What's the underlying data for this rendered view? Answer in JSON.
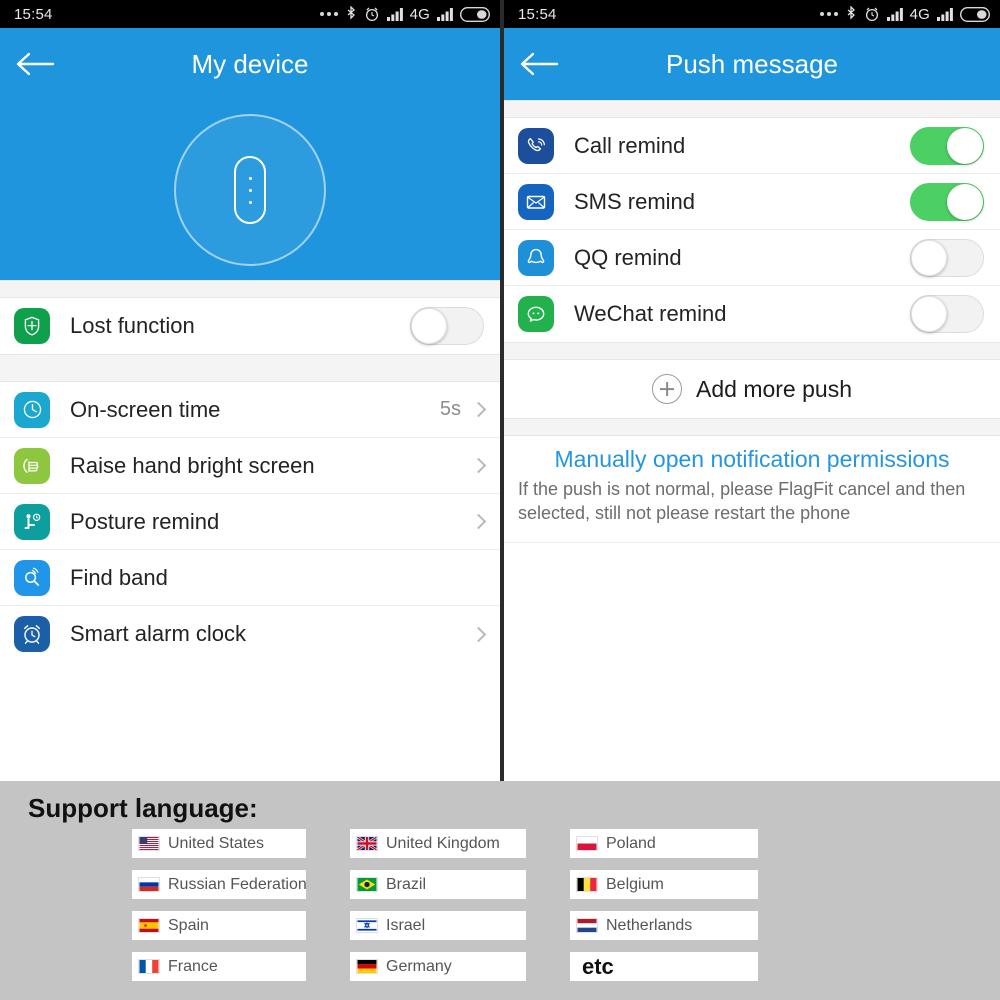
{
  "status_bar": {
    "time": "15:54",
    "icons": [
      "more-dots-icon",
      "bluetooth-icon",
      "alarm-icon",
      "signal-bars-icon",
      "battery-icon"
    ],
    "network": "4G"
  },
  "left_screen": {
    "appbar": {
      "title": "My device",
      "back_icon": "back-arrow-icon"
    },
    "hero": {
      "device_icon": "fitness-band-icon"
    },
    "lost_section": [
      {
        "label": "Lost function",
        "icon": "shield-target-icon",
        "icon_color": "#0ea04a",
        "toggle": "off"
      }
    ],
    "settings_section": [
      {
        "label": "On-screen time",
        "icon": "clock-icon",
        "icon_color": "#1aa8d0",
        "value": "5s",
        "chevron": true
      },
      {
        "label": "Raise hand bright screen",
        "icon": "raise-hand-icon",
        "icon_color": "#8dc63f",
        "value": "",
        "chevron": true
      },
      {
        "label": "Posture remind",
        "icon": "posture-icon",
        "icon_color": "#0d9e9e",
        "value": "",
        "chevron": true
      },
      {
        "label": "Find band",
        "icon": "find-band-icon",
        "icon_color": "#2196e8",
        "value": "",
        "chevron": false
      },
      {
        "label": "Smart alarm clock",
        "icon": "alarm-clock-icon",
        "icon_color": "#1b5fa8",
        "value": "",
        "chevron": true
      }
    ]
  },
  "right_screen": {
    "appbar": {
      "title": "Push message",
      "back_icon": "back-arrow-icon"
    },
    "push_items": [
      {
        "label": "Call remind",
        "icon": "phone-icon",
        "icon_color": "#1c4e9c",
        "toggle": "on"
      },
      {
        "label": "SMS remind",
        "icon": "envelope-icon",
        "icon_color": "#1565c0",
        "toggle": "on"
      },
      {
        "label": "QQ remind",
        "icon": "qq-penguin-icon",
        "icon_color": "#1e90d8",
        "toggle": "off"
      },
      {
        "label": "WeChat remind",
        "icon": "wechat-icon",
        "icon_color": "#22b14c",
        "toggle": "off"
      }
    ],
    "add_more": {
      "label": "Add more push",
      "icon": "plus-circle-icon"
    },
    "permissions": {
      "link": "Manually open notification permissions",
      "note": "If the push is not normal, please FlagFit cancel and then selected, still not please restart the phone"
    }
  },
  "support_language": {
    "title": "Support language:",
    "columns": [
      [
        {
          "name": "United States",
          "flag": "flag-us"
        },
        {
          "name": "Russian Federation",
          "flag": "flag-ru"
        },
        {
          "name": "Spain",
          "flag": "flag-es"
        },
        {
          "name": "France",
          "flag": "flag-fr"
        }
      ],
      [
        {
          "name": "United Kingdom",
          "flag": "flag-gb"
        },
        {
          "name": "Brazil",
          "flag": "flag-br"
        },
        {
          "name": "Israel",
          "flag": "flag-il"
        },
        {
          "name": "Germany",
          "flag": "flag-de"
        }
      ],
      [
        {
          "name": "Poland",
          "flag": "flag-pl"
        },
        {
          "name": "Belgium",
          "flag": "flag-be"
        },
        {
          "name": "Netherlands",
          "flag": "flag-nl"
        },
        {
          "name": "etc",
          "flag": ""
        }
      ]
    ]
  },
  "colors": {
    "appbar_blue": "#1e95dd",
    "toggle_on_green": "#4cd064",
    "link_blue": "#2496e0",
    "page_gray": "#c4c4c4"
  }
}
